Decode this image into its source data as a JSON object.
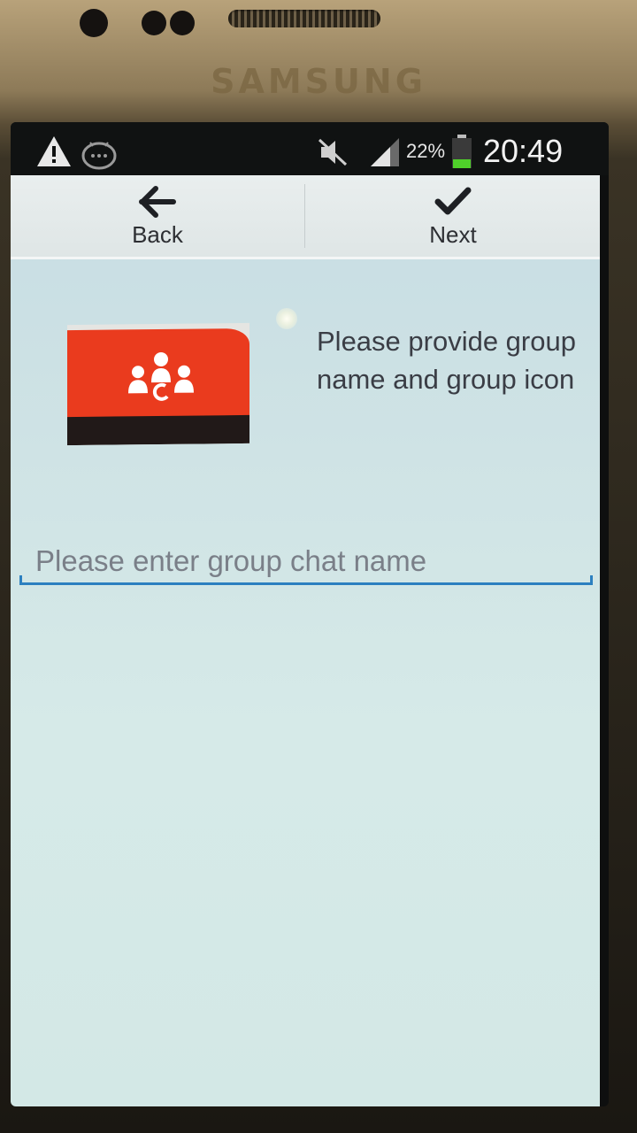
{
  "device": {
    "brand": "SAMSUNG"
  },
  "status_bar": {
    "icons": [
      "warning-icon",
      "android-debug-icon",
      "mute-icon",
      "signal-icon",
      "battery-icon"
    ],
    "battery_percent": "22%",
    "time": "20:49"
  },
  "action_bar": {
    "back": {
      "label": "Back",
      "icon": "arrow-left-icon"
    },
    "next": {
      "label": "Next",
      "icon": "checkmark-icon"
    }
  },
  "group": {
    "icon": "group-people-icon",
    "prompt": "Please provide group name and group icon"
  },
  "name_field": {
    "value": "",
    "placeholder": "Please enter group chat name"
  },
  "colors": {
    "accent_red": "#ea3b1e",
    "input_underline": "#2c80c0",
    "background": "#d3e8e6"
  }
}
